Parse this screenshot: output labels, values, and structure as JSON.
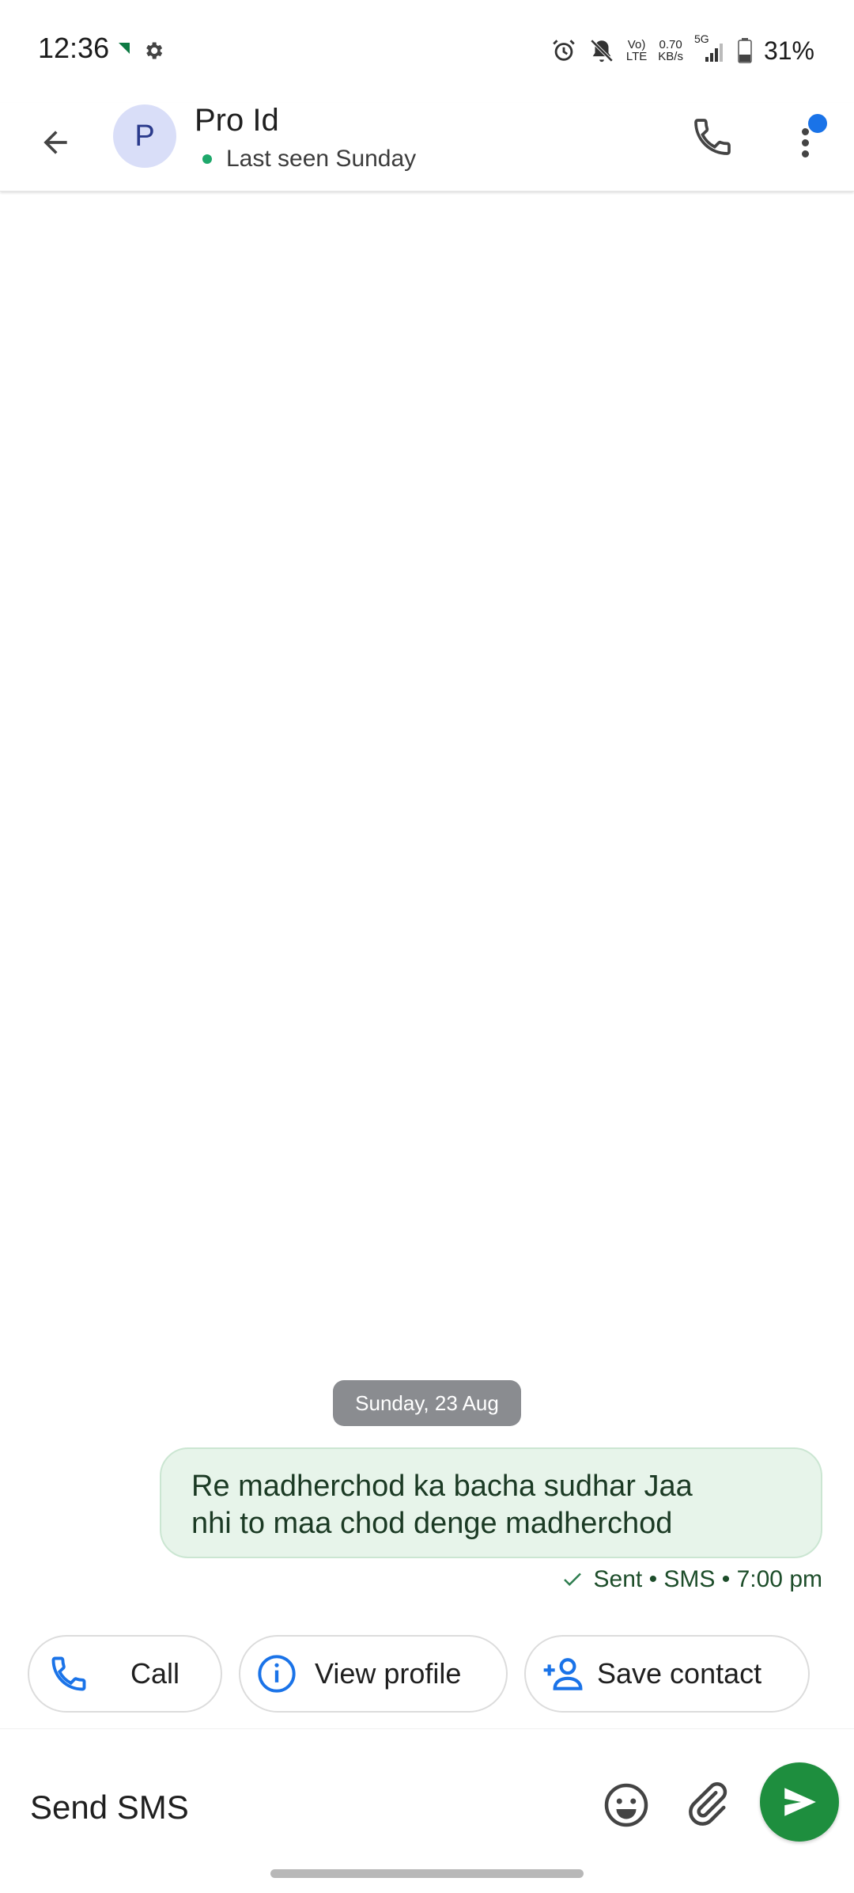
{
  "status_bar": {
    "time": "12:36",
    "network_top": "Vo)",
    "network_bottom": "LTE",
    "speed_top": "0.70",
    "speed_bottom": "KB/s",
    "signal_label": "5G",
    "battery_percent": "31%"
  },
  "header": {
    "avatar_letter": "P",
    "contact_name": "Pro Id",
    "last_seen": "Last seen Sunday",
    "online_color": "#1ea86b",
    "notification_color": "#1a73e8"
  },
  "conversation": {
    "date_chip": "Sunday, 23 Aug",
    "messages": [
      {
        "line1": "Re madherchod ka bacha sudhar Jaa",
        "line2": "nhi to maa chod denge madherchod",
        "status": "Sent • SMS • 7:00 pm"
      }
    ]
  },
  "suggestions": {
    "call_label": "Call",
    "view_profile_label": "View profile",
    "save_contact_label": "Save contact"
  },
  "compose": {
    "placeholder": "Send SMS"
  },
  "colors": {
    "accent_blue": "#1a73e8",
    "send_green": "#1e8e3e",
    "bubble_bg": "#e7f4ea"
  }
}
